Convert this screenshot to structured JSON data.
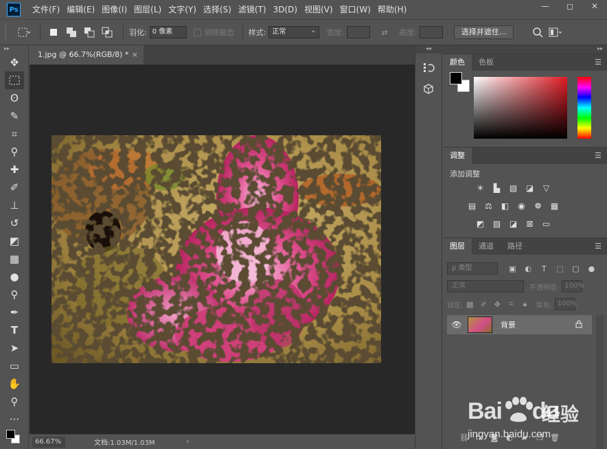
{
  "app": {
    "logo": "Ps"
  },
  "menu": [
    "文件(F)",
    "编辑(E)",
    "图像(I)",
    "图层(L)",
    "文字(Y)",
    "选择(S)",
    "滤镜(T)",
    "3D(D)",
    "视图(V)",
    "窗口(W)",
    "帮助(H)"
  ],
  "window_controls": {
    "minimize": "—",
    "restore": "◻",
    "close": "✕"
  },
  "options": {
    "feather_label": "羽化:",
    "feather_value": "0 像素",
    "antialias_label": "消除锯齿",
    "style_label": "样式:",
    "style_value": "正常",
    "width_label": "宽度:",
    "height_label": "高度:",
    "select_mask_button": "选择并遮住..."
  },
  "toolbar": {
    "collapse": "▸▸",
    "tools": [
      {
        "name": "move-tool",
        "glyph": "✥"
      },
      {
        "name": "marquee-tool",
        "glyph": "⬚",
        "active": true
      },
      {
        "name": "lasso-tool",
        "glyph": "ʘ"
      },
      {
        "name": "quick-select-tool",
        "glyph": "✎"
      },
      {
        "name": "crop-tool",
        "glyph": "⌗"
      },
      {
        "name": "eyedropper-tool",
        "glyph": "⚲"
      },
      {
        "name": "healing-brush-tool",
        "glyph": "✚"
      },
      {
        "name": "brush-tool",
        "glyph": "✐"
      },
      {
        "name": "stamp-tool",
        "glyph": "⊥"
      },
      {
        "name": "history-brush-tool",
        "glyph": "↺"
      },
      {
        "name": "eraser-tool",
        "glyph": "◩"
      },
      {
        "name": "gradient-tool",
        "glyph": "▦"
      },
      {
        "name": "blur-tool",
        "glyph": "●"
      },
      {
        "name": "dodge-tool",
        "glyph": "⚲"
      },
      {
        "name": "pen-tool",
        "glyph": "✒"
      },
      {
        "name": "type-tool",
        "glyph": "T"
      },
      {
        "name": "path-select-tool",
        "glyph": "➤"
      },
      {
        "name": "rectangle-tool",
        "glyph": "▭"
      },
      {
        "name": "hand-tool",
        "glyph": "✋"
      },
      {
        "name": "zoom-tool",
        "glyph": "⚲"
      },
      {
        "name": "more-tools",
        "glyph": "···"
      }
    ]
  },
  "document": {
    "tab_title": "1.jpg @ 66.7%(RGB/8) *",
    "close": "×",
    "zoom": "66.67%",
    "doc_info": "文档:1.03M/1.03M",
    "status_arrow": "›"
  },
  "color_panel": {
    "tabs": [
      "颜色",
      "色板"
    ],
    "menu": "☰"
  },
  "adjustments_panel": {
    "tabs": [
      "调整"
    ],
    "menu": "☰",
    "title": "添加调整"
  },
  "layers_panel": {
    "tabs": [
      "图层",
      "通道",
      "路径"
    ],
    "menu": "☰",
    "filter_kind": "ρ 类型",
    "blend_mode": "正常",
    "opacity_label": "不透明度:",
    "opacity_value": "100%",
    "lock_label": "锁定:",
    "fill_label": "填充:",
    "fill_value": "100%",
    "layers": [
      {
        "name": "背景",
        "visible": true,
        "locked": true
      }
    ]
  },
  "watermark": {
    "logo": "Bai",
    "logo_suffix": "du",
    "cn": "经验",
    "url": "jingyan.baidu.com"
  }
}
